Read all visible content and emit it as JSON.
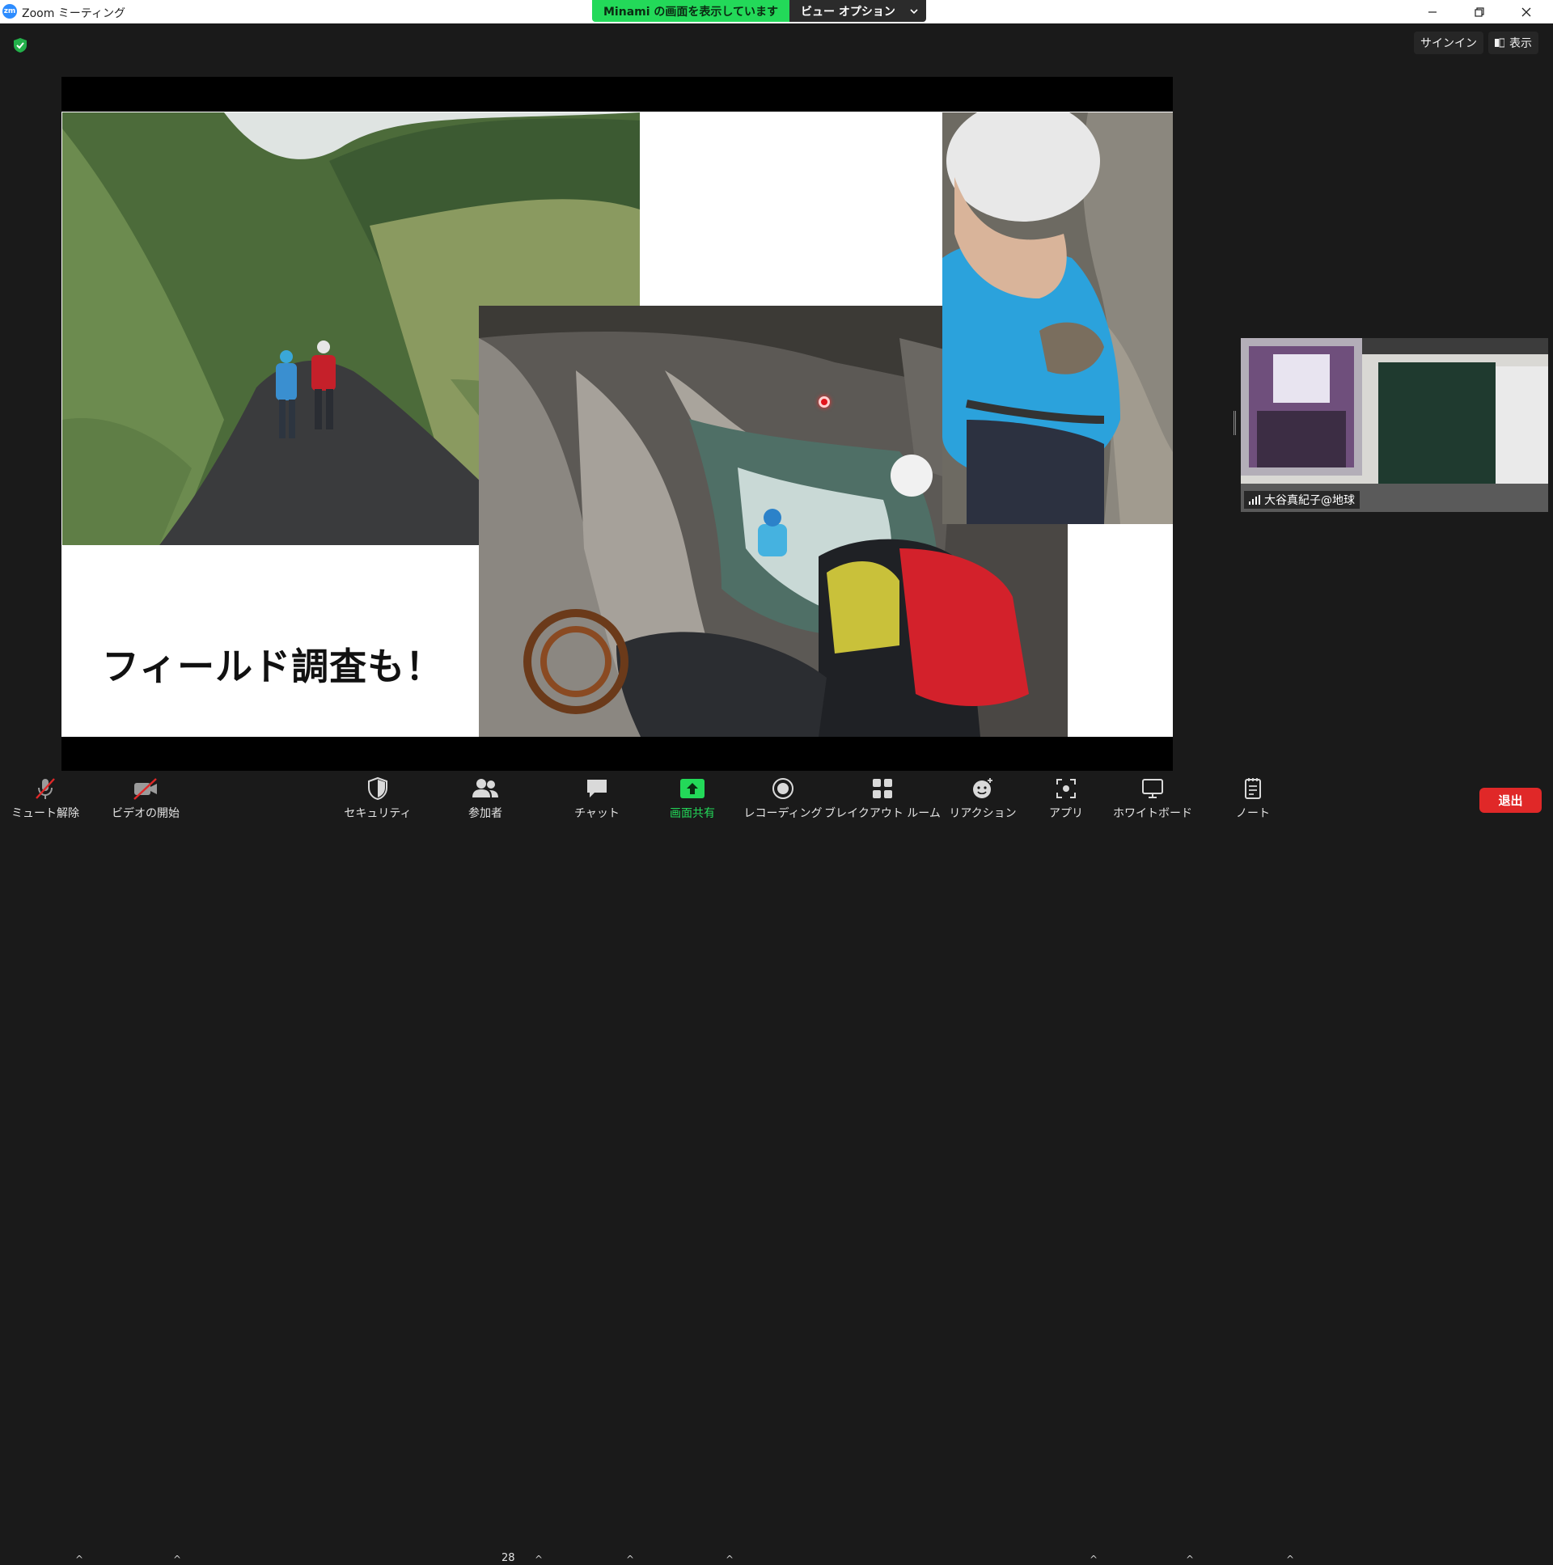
{
  "window": {
    "title": "Zoom ミーティング",
    "logo": "zm"
  },
  "share_banner": {
    "status": "Minami の画面を表示しています",
    "view_options": "ビュー オプション"
  },
  "top_right": {
    "signin": "サインイン",
    "view": "表示"
  },
  "slide": {
    "caption": "フィールド調査も！"
  },
  "participant": {
    "name": "大谷真紀子@地球"
  },
  "toolbar": {
    "mute": "ミュート解除",
    "video": "ビデオの開始",
    "security": "セキュリティ",
    "participants": "参加者",
    "participants_count": "28",
    "chat": "チャット",
    "share": "画面共有",
    "recording": "レコーディング",
    "breakout": "ブレイクアウト ルーム",
    "reactions": "リアクション",
    "apps": "アプリ",
    "whiteboard": "ホワイトボード",
    "notes": "ノート",
    "leave": "退出"
  },
  "colors": {
    "accent_green": "#23d959",
    "leave_red": "#e02828",
    "zoom_blue": "#2d8cff"
  }
}
